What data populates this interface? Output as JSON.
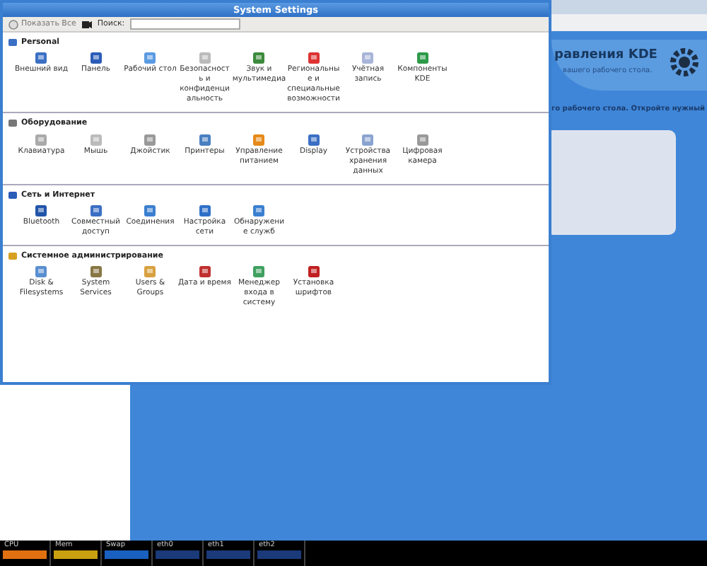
{
  "window": {
    "title": "System Settings"
  },
  "toolbar": {
    "show_all": "Показать Все",
    "search_label": "Поиск:"
  },
  "sections": [
    {
      "title": "Personal",
      "items": [
        "Внешний вид",
        "Панель",
        "Рабочий стол",
        "Безопасность и конфиденциальность",
        "Звук и мультимедиа",
        "Региональные и специальные возможности",
        "Учётная запись",
        "Компоненты KDE"
      ]
    },
    {
      "title": "Оборудование",
      "items": [
        "Клавиатура",
        "Мышь",
        "Джойстик",
        "Принтеры",
        "Управление питанием",
        "Display",
        "Устройства хранения данных",
        "Цифровая камера"
      ]
    },
    {
      "title": "Сеть и Интернет",
      "items": [
        "Bluetooth",
        "Совместный доступ",
        "Соединения",
        "Настройка сети",
        "Обнаружение служб"
      ]
    },
    {
      "title": "Системное администрирование",
      "items": [
        "Disk & Filesystems",
        "System Services",
        "Users & Groups",
        "Дата и время",
        "Менеджер входа в систему",
        "Установка шрифтов"
      ]
    }
  ],
  "background_window": {
    "banner_title": "равления KDE",
    "banner_subtitle": "вашего рабочего стола.",
    "hint": "го рабочего стола. Откройте нужный"
  },
  "system_monitor": [
    "CPU",
    "Mem",
    "Swap",
    "eth0",
    "eth1",
    "eth2"
  ]
}
